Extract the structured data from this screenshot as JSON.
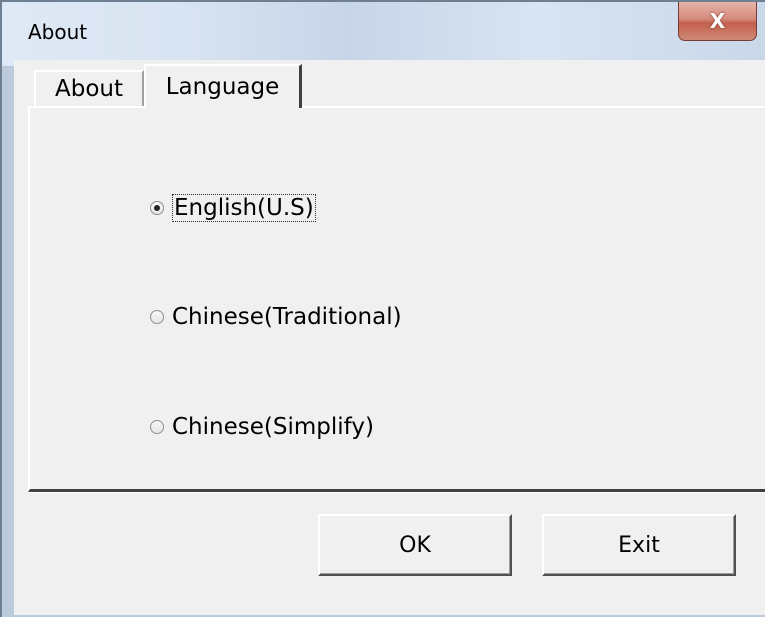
{
  "window": {
    "title": "About",
    "close_glyph": "X"
  },
  "tabs": [
    {
      "label": "About",
      "selected": false
    },
    {
      "label": "Language",
      "selected": true
    }
  ],
  "language_options": [
    {
      "label": "English(U.S)",
      "checked": true
    },
    {
      "label": "Chinese(Traditional)",
      "checked": false
    },
    {
      "label": "Chinese(Simplify)",
      "checked": false
    }
  ],
  "buttons": {
    "ok_label": "OK",
    "exit_label": "Exit"
  }
}
